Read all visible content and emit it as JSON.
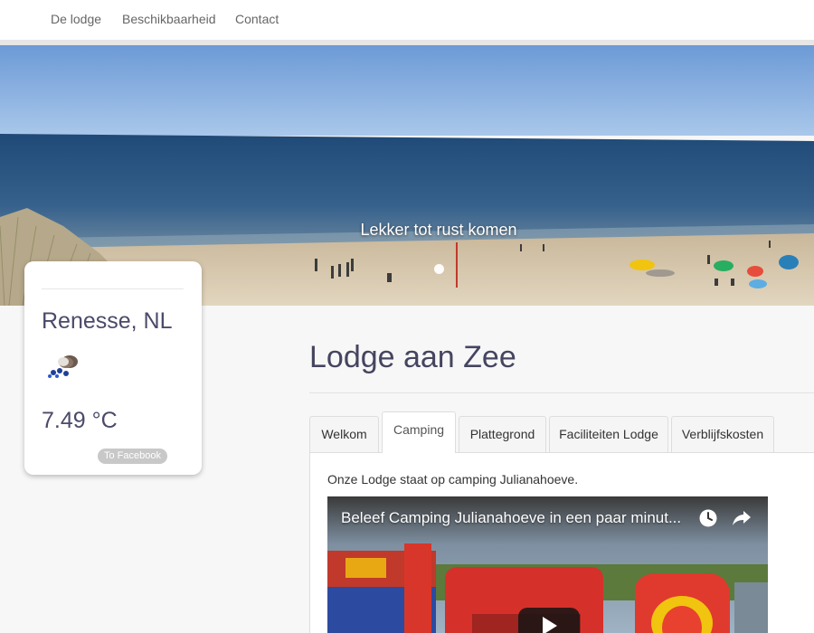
{
  "nav": {
    "items": [
      {
        "label": "De lodge"
      },
      {
        "label": "Beschikbaarheid"
      },
      {
        "label": "Contact"
      }
    ]
  },
  "hero": {
    "caption": "Lekker tot rust komen",
    "active_slide": 1
  },
  "weather": {
    "city": "Renesse, NL",
    "icon": "rain-cloud-icon",
    "temperature": "7.49 °C",
    "facebook_label": "To Facebook"
  },
  "main": {
    "title": "Lodge aan Zee",
    "tabs": [
      {
        "label": "Welkom",
        "active": false
      },
      {
        "label": "Camping",
        "active": true
      },
      {
        "label": "Plattegrond",
        "active": false
      },
      {
        "label": "Faciliteiten Lodge",
        "active": false
      },
      {
        "label": "Verblijfskosten",
        "active": false
      }
    ],
    "tab_content": {
      "text": "Onze Lodge staat op camping Julianahoeve.",
      "video": {
        "title": "Beleef Camping Julianahoeve in een paar minut...",
        "watch_later_icon": "clock-icon",
        "share_icon": "share-arrow-icon",
        "play_icon": "play-icon"
      }
    }
  },
  "colors": {
    "title": "#454560",
    "nav_text": "#666666",
    "sky": "#79a8dc",
    "sea": "#2f5a86",
    "sand": "#d6c7a8"
  }
}
